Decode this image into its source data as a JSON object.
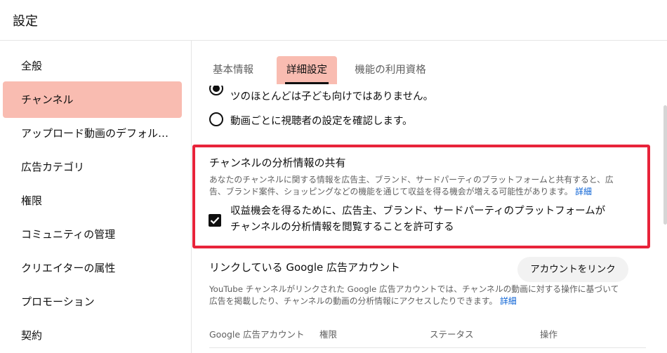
{
  "dialog": {
    "title": "設定"
  },
  "sidebar": {
    "items": [
      {
        "label": "全般"
      },
      {
        "label": "チャンネル"
      },
      {
        "label": "アップロード動画のデフォル…"
      },
      {
        "label": "広告カテゴリ"
      },
      {
        "label": "権限"
      },
      {
        "label": "コミュニティの管理"
      },
      {
        "label": "クリエイターの属性"
      },
      {
        "label": "プロモーション"
      },
      {
        "label": "契約"
      }
    ],
    "active_index": 1
  },
  "tabs": [
    {
      "label": "基本情報"
    },
    {
      "label": "詳細設定"
    },
    {
      "label": "機能の利用資格"
    }
  ],
  "audience": {
    "option_partial": "ツのほとんどは子ども向けではありません。",
    "option_review": "動画ごとに視聴者の設定を確認します。"
  },
  "analytics_sharing": {
    "title": "チャンネルの分析情報の共有",
    "description_line1": "あなたのチャンネルに関する情報を広告主、ブランド、サードパーティのプラットフォームと共有すると、広",
    "description_line2": "告、ブランド案件、ショッピングなどの機能を通じて収益を得る機会が増える可能性があります。",
    "learn_more": "詳細",
    "checkbox_line1": "収益機会を得るために、広告主、ブランド、サードパーティのプラットフォームが",
    "checkbox_line2": "チャンネルの分析情報を閲覧することを許可する",
    "checked": true
  },
  "google_ads": {
    "title": "リンクしている Google 広告アカウント",
    "link_button": "アカウントをリンク",
    "description_line1": "YouTube チャンネルがリンクされた Google 広告アカウントでは、チャンネルの動画に対する操作に基づいて",
    "description_line2": "広告を掲載したり、チャンネルの動画の分析情報にアクセスしたりできます。",
    "learn_more": "詳細",
    "columns": [
      "Google 広告アカウント",
      "権限",
      "ステータス",
      "操作"
    ]
  },
  "colors": {
    "active_highlight": "#f9bcb1",
    "callout_border": "#e8233a",
    "link": "#065fd4"
  }
}
